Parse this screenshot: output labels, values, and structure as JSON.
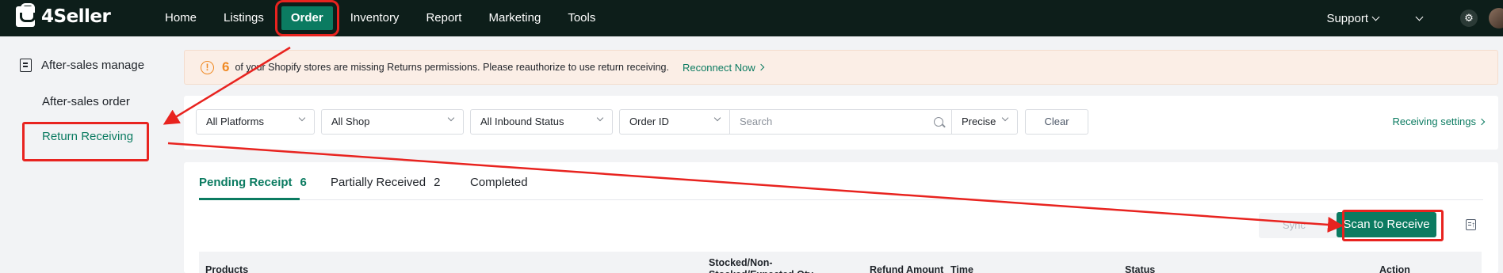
{
  "app": {
    "name": "4Seller"
  },
  "nav": {
    "items": [
      "Home",
      "Listings",
      "Order",
      "Inventory",
      "Report",
      "Marketing",
      "Tools"
    ],
    "active": "Order",
    "support": "Support"
  },
  "sidebar": {
    "group": "After-sales manage",
    "items": [
      "After-sales order",
      "Return Receiving"
    ],
    "active": "Return Receiving"
  },
  "banner": {
    "count": "6",
    "text": "of your Shopify stores are missing Returns permissions. Please reauthorize to use return receiving.",
    "link": "Reconnect Now"
  },
  "filters": {
    "platform": "All Platforms",
    "shop": "All Shop",
    "inbound_status": "All Inbound Status",
    "search_field": "Order ID",
    "search_placeholder": "Search",
    "match_mode": "Precise",
    "clear_label": "Clear",
    "settings_link": "Receiving settings"
  },
  "tabs": [
    {
      "label": "Pending Receipt",
      "count": "6"
    },
    {
      "label": "Partially Received",
      "count": "2"
    },
    {
      "label": "Completed",
      "count": ""
    }
  ],
  "actions": {
    "sync_label": "Sync",
    "scan_label": "Scan to Receive"
  },
  "table": {
    "headers": [
      "Products",
      "Stocked/Non-Stocked/Expected Qty",
      "Refund Amount",
      "Time",
      "Status",
      "Action"
    ]
  },
  "colors": {
    "brand": "#0b7b61",
    "topbar": "#0d1e1a",
    "warning": "#f08a24",
    "annotation": "#e8231f"
  }
}
